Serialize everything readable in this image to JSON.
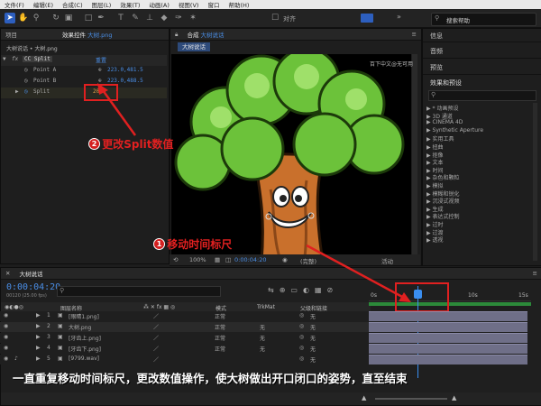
{
  "menu": [
    "文件(F)",
    "编辑(E)",
    "合成(C)",
    "图层(L)",
    "效果(T)",
    "动画(A)",
    "视图(V)",
    "窗口",
    "帮助(H)"
  ],
  "toolbar": {
    "align_label": "对齐",
    "search_placeholder": "搜索帮助"
  },
  "left_panel": {
    "tab_project": "项目",
    "tab_effects": "效果控件",
    "tab_effects_file": "大树.png",
    "breadcrumb": "大树说话 • 大树.png",
    "effect_name": "CC Split",
    "reset": "重置",
    "point_a_label": "Point A",
    "point_a_value": "223.0,481.5",
    "point_b_label": "Point B",
    "point_b_value": "223.0,488.5",
    "split_label": "Split",
    "split_value": "20.0"
  },
  "comp_panel": {
    "tab_label": "合成",
    "tab_name": "大树说话",
    "sub_tab": "大树说话",
    "zoom": "100%",
    "timecode": "0:00:04:20",
    "view_mode": "(完整)",
    "camera": "活动"
  },
  "watermark": "百下中文@无可用",
  "right_panel": {
    "items": [
      "信息",
      "音频",
      "预览"
    ],
    "effects_title": "效果和预设",
    "categories": [
      "* 动画预设",
      "3D 通道",
      "CINEMA 4D",
      "Synthetic Aperture",
      "实用工具",
      "扭曲",
      "抠像",
      "文本",
      "时间",
      "杂色和颗粒",
      "模拟",
      "模糊和锐化",
      "沉浸式视频",
      "生成",
      "表达式控制",
      "过时",
      "过渡",
      "透视"
    ]
  },
  "timeline": {
    "tab_name": "大树说话",
    "timecode": "0:00:04:20",
    "timecode_sub": "00120 (25.00 fps)",
    "col_layer_name": "图层名称",
    "col_mode": "模式",
    "col_trkmat": "TrkMat",
    "col_parent": "父级和链接",
    "ruler_labels": [
      "0s",
      "10s",
      "15s"
    ],
    "layers": [
      {
        "num": "1",
        "name": "[眼睛1.png]",
        "mode": "正常",
        "trk": "",
        "parent": "无"
      },
      {
        "num": "2",
        "name": "大树.png",
        "mode": "正常",
        "trk": "无",
        "parent": "无"
      },
      {
        "num": "3",
        "name": "[牙齿上.png]",
        "mode": "正常",
        "trk": "无",
        "parent": "无"
      },
      {
        "num": "4",
        "name": "[牙齿下.png]",
        "mode": "正常",
        "trk": "无",
        "parent": "无"
      },
      {
        "num": "5",
        "name": "[9799.wav]",
        "mode": "",
        "trk": "",
        "parent": "无"
      }
    ]
  },
  "annotations": {
    "step1_num": "1",
    "step1_text": "移动时间标尺",
    "step2_num": "2",
    "step2_text": "更改Split数值",
    "bottom_text": "一直重复移动时间标尺，更改数值操作，使大树做出开口闭口的姿势，直至结束",
    "accent": "#e02020"
  }
}
